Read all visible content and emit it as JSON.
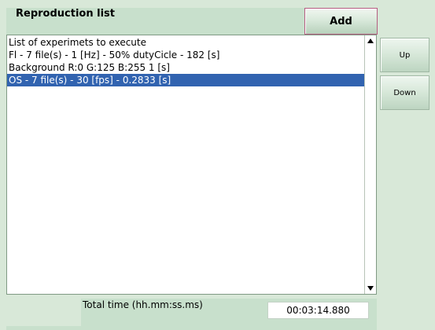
{
  "header": {
    "title": "Reproduction list",
    "add_label": "Add"
  },
  "list": {
    "items": [
      {
        "label": "List of experimets to execute",
        "selected": false
      },
      {
        "label": "Fl - 7 file(s) - 1 [Hz] - 50% dutyCicle - 182 [s]",
        "selected": false
      },
      {
        "label": "Background R:0 G:125 B:255 1 [s]",
        "selected": false
      },
      {
        "label": "OS - 7 file(s) - 30 [fps] - 0.2833 [s]",
        "selected": true
      }
    ],
    "selection_color": "#3163b0"
  },
  "side_buttons": {
    "up_label": "Up",
    "down_label": "Down"
  },
  "footer": {
    "total_label": "Total time (hh.mm:ss.ms)",
    "total_value": "00:03:14.880"
  },
  "icons": {
    "scroll_up": "triangle-up-icon",
    "scroll_down": "triangle-down-icon"
  }
}
